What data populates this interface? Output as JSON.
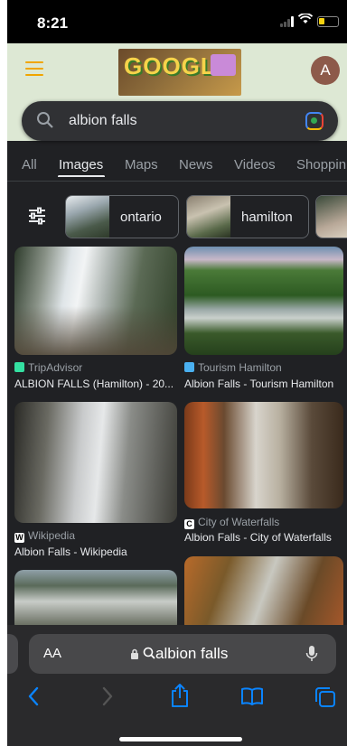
{
  "status": {
    "time": "8:21"
  },
  "header": {
    "doodle_text": "GOOGLE",
    "avatar_letter": "A"
  },
  "search": {
    "query": "albion falls"
  },
  "tabs": [
    {
      "label": "All"
    },
    {
      "label": "Images"
    },
    {
      "label": "Maps"
    },
    {
      "label": "News"
    },
    {
      "label": "Videos"
    },
    {
      "label": "Shoppin"
    }
  ],
  "chips": [
    {
      "label": "ontario"
    },
    {
      "label": "hamilton"
    }
  ],
  "results": [
    {
      "source": "TripAdvisor",
      "title": "ALBION FALLS (Hamilton) - 20...",
      "fav_color": "#34e0a1"
    },
    {
      "source": "Tourism Hamilton",
      "title": "Albion Falls - Tourism Hamilton",
      "fav_color": "#4ab0f0"
    },
    {
      "source": "Wikipedia",
      "title": "Albion Falls - Wikipedia",
      "fav_color": "#ffffff"
    },
    {
      "source": "City of Waterfalls",
      "title": "Albion Falls - City of Waterfalls",
      "fav_color": "#ffffff"
    }
  ],
  "browser": {
    "aa_label": "AA",
    "url_text": "albion falls"
  },
  "colors": {
    "background": "#202124",
    "header_bg": "#dde8d4",
    "accent": "#f0a500",
    "link_blue": "#0a84ff"
  }
}
